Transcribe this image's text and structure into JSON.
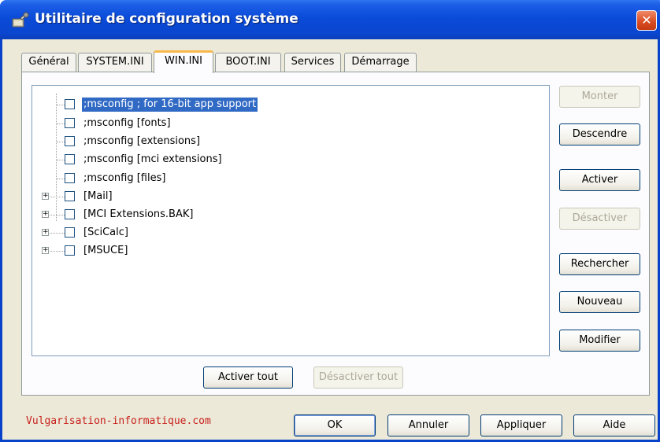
{
  "window": {
    "title": "Utilitaire de configuration système",
    "close_symbol": "✕"
  },
  "tabs": [
    {
      "label": "Général",
      "active": false
    },
    {
      "label": "SYSTEM.INI",
      "active": false
    },
    {
      "label": "WIN.INI",
      "active": true
    },
    {
      "label": "BOOT.INI",
      "active": false
    },
    {
      "label": "Services",
      "active": false
    },
    {
      "label": "Démarrage",
      "active": false
    }
  ],
  "tree": {
    "items": [
      {
        "label": ";msconfig ; for 16-bit app support",
        "checked": false,
        "expandable": false,
        "selected": true
      },
      {
        "label": ";msconfig [fonts]",
        "checked": false,
        "expandable": false,
        "selected": false
      },
      {
        "label": ";msconfig [extensions]",
        "checked": false,
        "expandable": false,
        "selected": false
      },
      {
        "label": ";msconfig [mci extensions]",
        "checked": false,
        "expandable": false,
        "selected": false
      },
      {
        "label": ";msconfig [files]",
        "checked": false,
        "expandable": false,
        "selected": false
      },
      {
        "label": "[Mail]",
        "checked": false,
        "expandable": true,
        "selected": false
      },
      {
        "label": "[MCI Extensions.BAK]",
        "checked": false,
        "expandable": true,
        "selected": false
      },
      {
        "label": "[SciCalc]",
        "checked": false,
        "expandable": true,
        "selected": false
      },
      {
        "label": "[MSUCE]",
        "checked": false,
        "expandable": true,
        "selected": false
      }
    ],
    "expander_symbol": "+"
  },
  "side_buttons": {
    "up": "Monter",
    "down": "Descendre",
    "enable": "Activer",
    "disable": "Désactiver",
    "search": "Rechercher",
    "new": "Nouveau",
    "edit": "Modifier"
  },
  "bottom_buttons": {
    "enable_all": "Activer tout",
    "disable_all": "Désactiver tout"
  },
  "dialog_buttons": {
    "ok": "OK",
    "cancel": "Annuler",
    "apply": "Appliquer",
    "help": "Aide"
  },
  "watermark": "Vulgarisation-informatique.com",
  "colors": {
    "titlebar": "#0a4bd8",
    "selection": "#316ac5",
    "watermark": "#c8201c",
    "active_tab_accent": "#f8b94c"
  },
  "icons": {
    "title": "msconfig-app-icon",
    "close": "close-icon",
    "expand": "plus-expander-icon",
    "checkbox": "checkbox-icon"
  }
}
